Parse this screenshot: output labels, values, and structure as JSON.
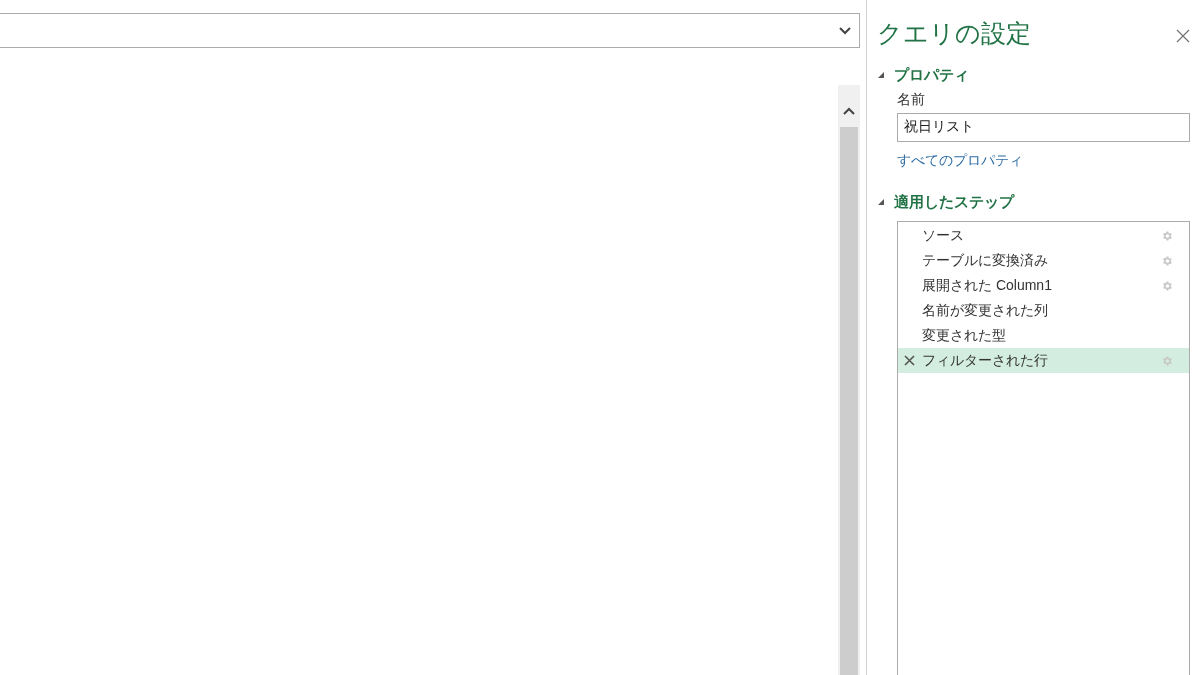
{
  "panel": {
    "title": "クエリの設定"
  },
  "properties": {
    "heading": "プロパティ",
    "expanded": true,
    "name_label": "名前",
    "name_value": "祝日リスト",
    "link": "すべてのプロパティ"
  },
  "steps": {
    "heading": "適用したステップ",
    "expanded": true,
    "items": [
      {
        "label": "ソース",
        "has_settings": true,
        "selected": false
      },
      {
        "label": "テーブルに変換済み",
        "has_settings": true,
        "selected": false
      },
      {
        "label": "展開された Column1",
        "has_settings": true,
        "selected": false
      },
      {
        "label": "名前が変更された列",
        "has_settings": false,
        "selected": false
      },
      {
        "label": "変更された型",
        "has_settings": false,
        "selected": false
      },
      {
        "label": "フィルターされた行",
        "has_settings": true,
        "selected": true
      }
    ]
  }
}
